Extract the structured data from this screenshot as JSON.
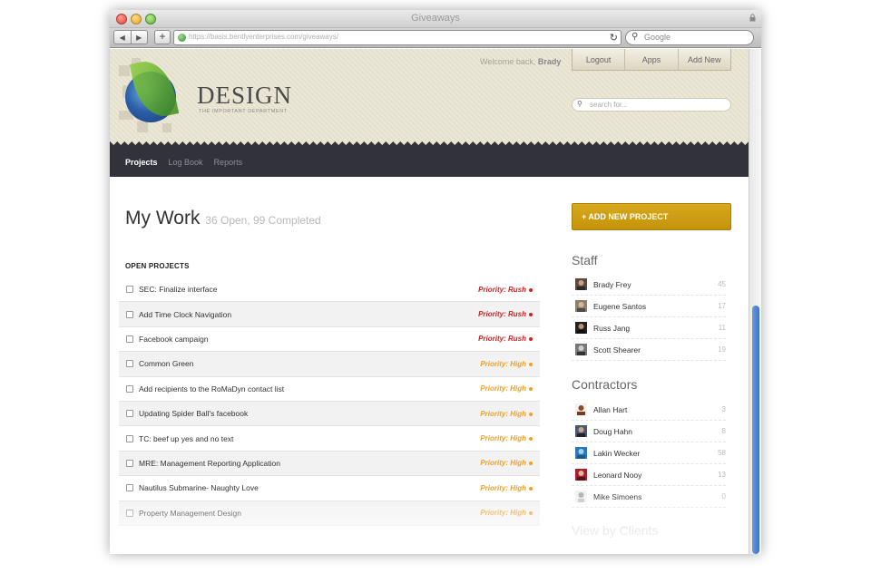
{
  "browser": {
    "title": "Giveaways",
    "url": "https://basis.bentlyenterprises.com/giveaways/",
    "search_placeholder": "Google"
  },
  "header": {
    "logo_title": "DESIGN",
    "logo_subtitle": "THE IMPORTANT DEPARTMENT",
    "welcome_text": "Welcome back, ",
    "welcome_user": "Brady",
    "buttons": [
      "Logout",
      "Apps",
      "Add New"
    ],
    "search_placeholder": "search for..."
  },
  "nav": {
    "items": [
      "Projects",
      "Log Book",
      "Reports"
    ],
    "active": "Projects"
  },
  "main": {
    "title": "My Work",
    "count_text": "36 Open, 99 Completed",
    "open_heading": "OPEN PROJECTS",
    "projects": [
      {
        "name": "SEC: Finalize interface",
        "priority": "Priority: Rush",
        "level": "rush"
      },
      {
        "name": "Add Time Clock Navigation",
        "priority": "Priority: Rush",
        "level": "rush"
      },
      {
        "name": "Facebook campaign",
        "priority": "Priority: Rush",
        "level": "rush"
      },
      {
        "name": "Common Green",
        "priority": "Priority: High",
        "level": "high"
      },
      {
        "name": "Add recipients to the RoMaDyn contact list",
        "priority": "Priority: High",
        "level": "high"
      },
      {
        "name": "Updating Spider Ball's facebook",
        "priority": "Priority: High",
        "level": "high"
      },
      {
        "name": "TC: beef up yes and no text",
        "priority": "Priority: High",
        "level": "high"
      },
      {
        "name": "MRE: Management Reporting Application",
        "priority": "Priority: High",
        "level": "high"
      },
      {
        "name": "Nautilus Submarine- Naughty Love",
        "priority": "Priority: High",
        "level": "high"
      },
      {
        "name": "Property Management Design",
        "priority": "Priority: High",
        "level": "high"
      }
    ]
  },
  "sidebar": {
    "add_button": "+ ADD NEW PROJECT",
    "staff_heading": "Staff",
    "staff": [
      {
        "name": "Brady Frey",
        "count": "45"
      },
      {
        "name": "Eugene Santos",
        "count": "17"
      },
      {
        "name": "Russ Jang",
        "count": "11"
      },
      {
        "name": "Scott Shearer",
        "count": "19"
      }
    ],
    "contractors_heading": "Contractors",
    "contractors": [
      {
        "name": "Allan Hart",
        "count": "3"
      },
      {
        "name": "Doug Hahn",
        "count": "8"
      },
      {
        "name": "Lakin Wecker",
        "count": "58"
      },
      {
        "name": "Leonard Nooy",
        "count": "13"
      },
      {
        "name": "Mike Simoens",
        "count": "0"
      }
    ],
    "view_heading": "View by Clients"
  },
  "colors": {
    "accent": "#c99a10",
    "nav_bg": "#31323a",
    "rush": "#d42020",
    "high": "#f0a020"
  }
}
